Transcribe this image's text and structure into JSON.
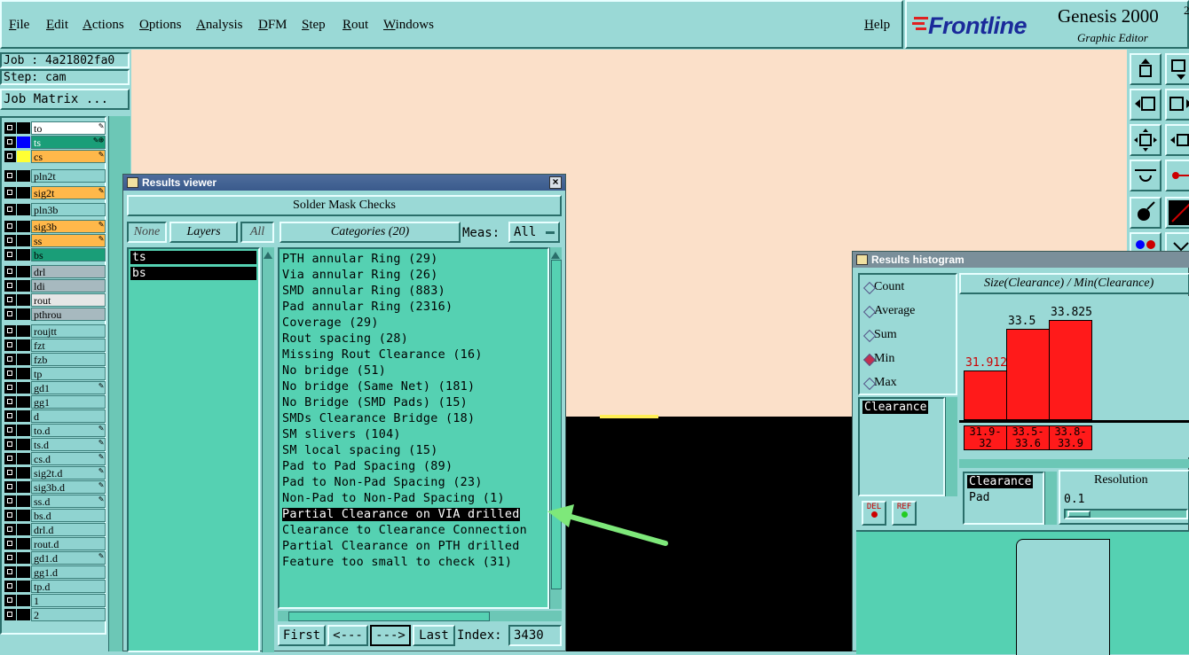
{
  "menu": {
    "items": [
      "File",
      "Edit",
      "Actions",
      "Options",
      "Analysis",
      "DFM",
      "Step",
      "Rout",
      "Windows"
    ],
    "help": "Help"
  },
  "brand": {
    "logo": "Frontline",
    "product": "Genesis 2000",
    "superscript": "2",
    "subtitle": "Graphic Editor"
  },
  "job": {
    "job_label": "Job : 4a21802fa0",
    "step_label": "Step: cam",
    "matrix_button": "Job Matrix ..."
  },
  "layers": [
    {
      "name": "to",
      "color": "#ffffff",
      "swatch": "#000000",
      "mark": "edit"
    },
    {
      "name": "ts",
      "color": "#1a9e78",
      "swatch": "#0000ff",
      "mark": "edit-target",
      "text_color": "#ffffff"
    },
    {
      "name": "cs",
      "color": "#ffb84a",
      "swatch": "#ffff33",
      "mark": "edit"
    },
    {
      "name": "pln2t",
      "color": "#8fd3d0",
      "swatch": "#000000",
      "mark": ""
    },
    {
      "name": "sig2t",
      "color": "#ffb84a",
      "swatch": "#000000",
      "mark": "edit"
    },
    {
      "name": "pln3b",
      "color": "#8fd3d0",
      "swatch": "#000000",
      "mark": ""
    },
    {
      "name": "sig3b",
      "color": "#ffb84a",
      "swatch": "#000000",
      "mark": "edit"
    },
    {
      "name": "ss",
      "color": "#ffb84a",
      "swatch": "#000000",
      "mark": "edit"
    },
    {
      "name": "bs",
      "color": "#1a9e78",
      "swatch": "#000000",
      "mark": ""
    },
    {
      "name": "drl",
      "color": "#a7b9bf",
      "swatch": "#000000",
      "mark": ""
    },
    {
      "name": "ldi",
      "color": "#a7b9bf",
      "swatch": "#000000",
      "mark": ""
    },
    {
      "name": "rout",
      "color": "#e6e6e6",
      "swatch": "#000000",
      "mark": ""
    },
    {
      "name": "pthrou",
      "color": "#a7b9bf",
      "swatch": "#000000",
      "mark": ""
    },
    {
      "name": "roujtt",
      "color": "#8fd3d0",
      "swatch": "#000000",
      "mark": ""
    },
    {
      "name": "fzt",
      "color": "#8fd3d0",
      "swatch": "#000000",
      "mark": ""
    },
    {
      "name": "fzb",
      "color": "#8fd3d0",
      "swatch": "#000000",
      "mark": ""
    },
    {
      "name": "tp",
      "color": "#8fd3d0",
      "swatch": "#000000",
      "mark": ""
    },
    {
      "name": "gd1",
      "color": "#8fd3d0",
      "swatch": "#000000",
      "mark": "edit"
    },
    {
      "name": "gg1",
      "color": "#8fd3d0",
      "swatch": "#000000",
      "mark": ""
    },
    {
      "name": "d",
      "color": "#8fd3d0",
      "swatch": "#000000",
      "mark": ""
    },
    {
      "name": "to.d",
      "color": "#8fd3d0",
      "swatch": "#000000",
      "mark": "edit"
    },
    {
      "name": "ts.d",
      "color": "#8fd3d0",
      "swatch": "#000000",
      "mark": "edit"
    },
    {
      "name": "cs.d",
      "color": "#8fd3d0",
      "swatch": "#000000",
      "mark": "edit"
    },
    {
      "name": "sig2t.d",
      "color": "#8fd3d0",
      "swatch": "#000000",
      "mark": "edit"
    },
    {
      "name": "sig3b.d",
      "color": "#8fd3d0",
      "swatch": "#000000",
      "mark": "edit"
    },
    {
      "name": "ss.d",
      "color": "#8fd3d0",
      "swatch": "#000000",
      "mark": "edit"
    },
    {
      "name": "bs.d",
      "color": "#8fd3d0",
      "swatch": "#000000",
      "mark": ""
    },
    {
      "name": "drl.d",
      "color": "#8fd3d0",
      "swatch": "#000000",
      "mark": ""
    },
    {
      "name": "rout.d",
      "color": "#8fd3d0",
      "swatch": "#000000",
      "mark": ""
    },
    {
      "name": "gd1.d",
      "color": "#8fd3d0",
      "swatch": "#000000",
      "mark": "edit"
    },
    {
      "name": "gg1.d",
      "color": "#8fd3d0",
      "swatch": "#000000",
      "mark": ""
    },
    {
      "name": "tp.d",
      "color": "#8fd3d0",
      "swatch": "#000000",
      "mark": ""
    },
    {
      "name": "1",
      "color": "#8fd3d0",
      "swatch": "#000000",
      "mark": ""
    },
    {
      "name": "2",
      "color": "#8fd3d0",
      "swatch": "#000000",
      "mark": ""
    }
  ],
  "results_viewer": {
    "title": "Results viewer",
    "header": "Solder Mask Checks",
    "none_btn": "None",
    "layers_btn": "Layers",
    "all_btn": "All",
    "categories_btn": "Categories (20)",
    "meas_label": "Meas:",
    "meas_value": "All",
    "layer_list": [
      "ts",
      "bs"
    ],
    "categories": [
      "PTH annular Ring (29)",
      "Via annular Ring (26)",
      "SMD annular Ring (883)",
      "Pad annular Ring (2316)",
      "Coverage (29)",
      "Rout spacing (28)",
      "Missing Rout Clearance (16)",
      "No bridge (51)",
      "No bridge (Same Net) (181)",
      "No Bridge (SMD Pads) (15)",
      "SMDs Clearance Bridge (18)",
      "SM slivers (104)",
      "SM local spacing (15)",
      "Pad to Pad Spacing (89)",
      "Pad to Non-Pad Spacing (23)",
      "Non-Pad to Non-Pad Spacing (1)",
      "Partial Clearance on VIA drilled",
      "Clearance to Clearance Connection",
      "Partial Clearance on PTH drilled",
      "Feature too small to check (31)"
    ],
    "selected_index": 16,
    "nav": {
      "first": "First",
      "prev": "<---",
      "next": "--->",
      "last": "Last",
      "index_label": "Index:",
      "index_value": "3430"
    }
  },
  "histogram": {
    "title": "Results histogram",
    "modes": [
      "Count",
      "Average",
      "Sum",
      "Min",
      "Max"
    ],
    "selected_mode": "Min",
    "measure_list": [
      "Clearance"
    ],
    "del_btn": "DEL",
    "ref_btn": "REF",
    "header": "Size(Clearance) / Min(Clearance)",
    "chart_data": {
      "type": "bar",
      "categories": [
        "31.9-32",
        "33.5-33.6",
        "33.8-33.9"
      ],
      "values": [
        31.912,
        33.5,
        33.825
      ],
      "value_labels": [
        "31.912",
        "33.5",
        "33.825"
      ]
    },
    "type_list": [
      "Clearance",
      "Pad"
    ],
    "resolution_label": "Resolution",
    "resolution_value": "0.1"
  },
  "colors": {
    "panel": "#9ad9d6",
    "list": "#55d1b2",
    "canvas": "#fbe0c9",
    "bar": "#ff1a1a",
    "arrow": "#7ee87a"
  }
}
